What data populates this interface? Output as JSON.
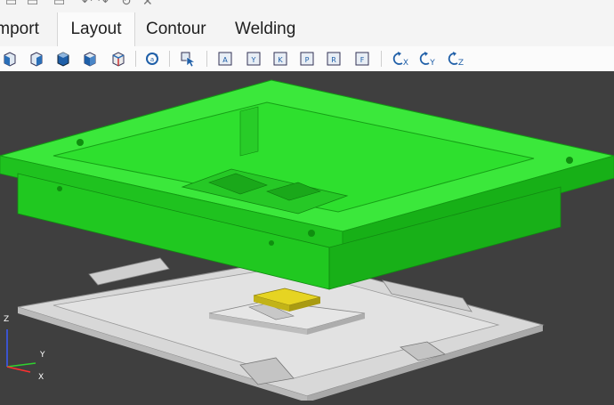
{
  "ribbon": {
    "tabs": [
      {
        "label": "Import",
        "active": false
      },
      {
        "label": "Layout",
        "active": true
      },
      {
        "label": "Contour",
        "active": false
      },
      {
        "label": "Welding",
        "active": false
      }
    ]
  },
  "toolbar": {
    "buttons": [
      {
        "icon": "view-left-cube-icon"
      },
      {
        "icon": "view-right-cube-icon"
      },
      {
        "icon": "view-front-cube-icon"
      },
      {
        "icon": "view-back-cube-icon"
      },
      {
        "icon": "view-iso-cube-icon"
      },
      {
        "icon": "rotate-view-icon"
      },
      {
        "icon": "select-pointer-icon"
      },
      {
        "icon": "view-a-icon"
      },
      {
        "icon": "view-y-icon"
      },
      {
        "icon": "view-k-icon"
      },
      {
        "icon": "view-p-icon"
      },
      {
        "icon": "view-r-icon"
      },
      {
        "icon": "view-f-icon"
      },
      {
        "icon": "rotate-x-icon",
        "label": "X"
      },
      {
        "icon": "rotate-y-icon",
        "label": "Y"
      },
      {
        "icon": "rotate-z-icon",
        "label": "Z"
      }
    ]
  },
  "viewport": {
    "background": "#3f3f3f",
    "part_color": "#2ee02e",
    "base_color": "#cfcfcf",
    "highlight_color": "#e6d422",
    "axis_labels": {
      "z": "Z",
      "y": "Y",
      "x": "X"
    }
  }
}
